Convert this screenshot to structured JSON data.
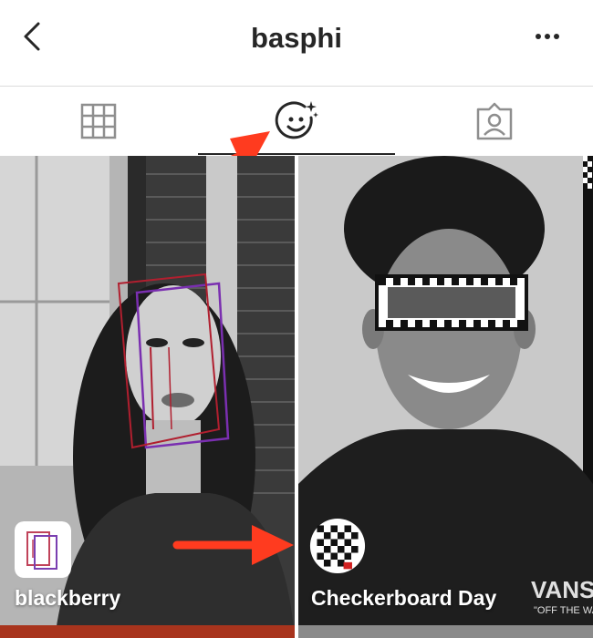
{
  "header": {
    "title": "basphi"
  },
  "tabs": [
    {
      "name": "grid",
      "icon": "grid-icon",
      "active": false
    },
    {
      "name": "effects",
      "icon": "face-sparkle-icon",
      "active": true
    },
    {
      "name": "tagged",
      "icon": "tagged-person-icon",
      "active": false
    }
  ],
  "effects": [
    {
      "label": "blackberry",
      "icon": "blackberry-effect-icon"
    },
    {
      "label": "Checkerboard Day",
      "icon": "checkerboard-effect-icon"
    }
  ],
  "colors": {
    "accent_arrow": "#ff3b1f",
    "text": "#262626",
    "divider": "#dbdbdb"
  }
}
